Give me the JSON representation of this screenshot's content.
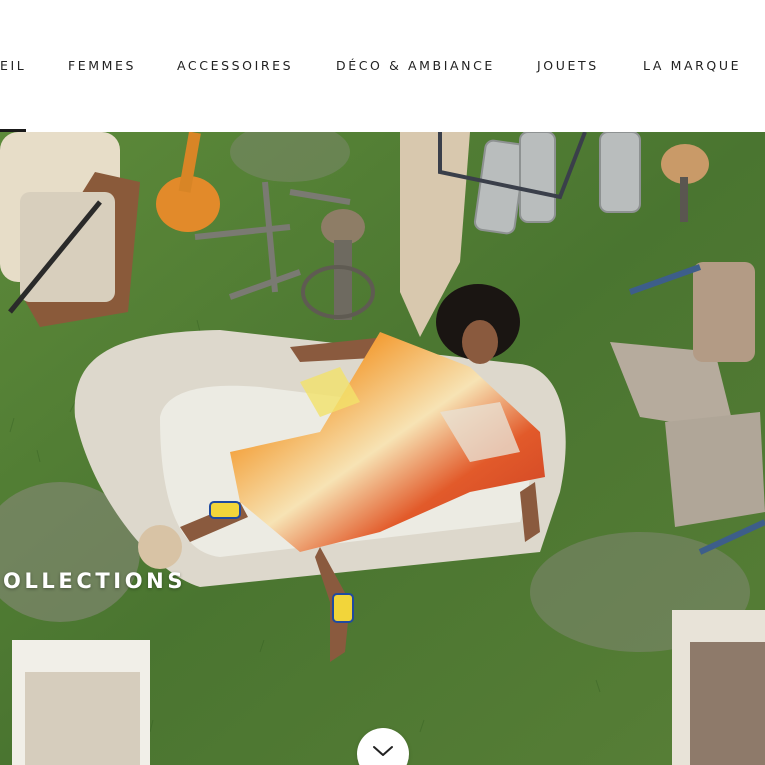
{
  "nav": {
    "items": [
      {
        "label": "EIL"
      },
      {
        "label": "FEMMES"
      },
      {
        "label": "ACCESSOIRES"
      },
      {
        "label": "DÉCO & AMBIANCE"
      },
      {
        "label": "JOUETS"
      },
      {
        "label": "LA MARQUE"
      }
    ]
  },
  "hero": {
    "title": "OLLECTIONS",
    "scroll_icon": "chevron-down-icon"
  },
  "colors": {
    "nav_text": "#222222",
    "grass": "#4f7a33",
    "sofa": "#e6e1d6",
    "dress_orange": "#ef8a2e",
    "dress_blue": "#2d6fd6"
  }
}
